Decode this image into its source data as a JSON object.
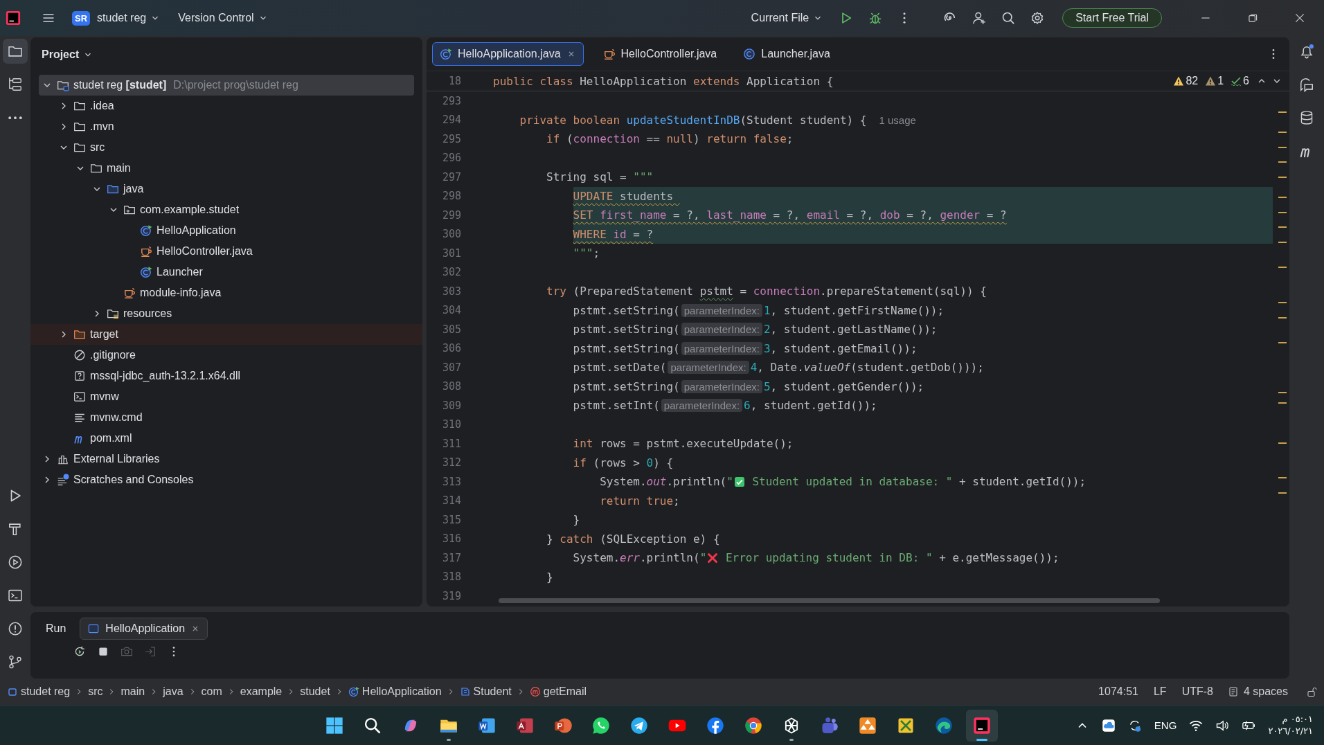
{
  "title_bar": {
    "project_badge": "SR",
    "project": "studet reg",
    "vcs": "Version Control",
    "run_config": "Current File",
    "trial_button": "Start Free Trial"
  },
  "left_toolbar": {
    "top": [
      {
        "kind": "project",
        "selected": true
      },
      {
        "kind": "structure",
        "selected": false
      },
      {
        "kind": "more",
        "selected": false
      }
    ],
    "bottom": [
      {
        "kind": "run",
        "selected": false
      },
      {
        "kind": "build",
        "selected": false
      },
      {
        "kind": "services",
        "selected": false
      },
      {
        "kind": "terminal",
        "selected": false
      },
      {
        "kind": "problems",
        "selected": false
      },
      {
        "kind": "git",
        "selected": false
      }
    ]
  },
  "project_panel": {
    "title": "Project",
    "tree": [
      {
        "label": "studet reg **[studet]**",
        "path": "D:\\project prog\\studet reg",
        "kind": "module",
        "expanded": true,
        "selected": true,
        "children": [
          {
            "label": ".idea",
            "kind": "folder",
            "expanded": false,
            "selected": false
          },
          {
            "label": ".mvn",
            "kind": "folder",
            "expanded": false,
            "selected": false
          },
          {
            "label": "src",
            "kind": "folder",
            "expanded": true,
            "selected": false,
            "children": [
              {
                "label": "main",
                "kind": "folder",
                "expanded": true,
                "selected": false,
                "children": [
                  {
                    "label": "java",
                    "kind": "source",
                    "expanded": true,
                    "selected": false,
                    "children": [
                      {
                        "label": "com.example.studet",
                        "kind": "package",
                        "expanded": true,
                        "selected": false,
                        "children": [
                          {
                            "label": "HelloApplication",
                            "kind": "class-run",
                            "selected": false
                          },
                          {
                            "label": "HelloController.java",
                            "kind": "java",
                            "selected": false
                          },
                          {
                            "label": "Launcher",
                            "kind": "class-run",
                            "selected": false
                          }
                        ]
                      },
                      {
                        "label": "module-info.java",
                        "kind": "java",
                        "selected": false
                      }
                    ]
                  },
                  {
                    "label": "resources",
                    "kind": "resources",
                    "expanded": false,
                    "selected": false
                  }
                ]
              }
            ]
          },
          {
            "label": "target",
            "kind": "excluded",
            "expanded": false,
            "selected": false
          },
          {
            "label": ".gitignore",
            "kind": "ignore",
            "selected": false
          },
          {
            "label": "mssql-jdbc_auth-13.2.1.x64.dll",
            "kind": "unknown",
            "selected": false
          },
          {
            "label": "mvnw",
            "kind": "terminal",
            "selected": false
          },
          {
            "label": "mvnw.cmd",
            "kind": "lines",
            "selected": false
          },
          {
            "label": "pom.xml",
            "kind": "maven",
            "selected": false
          }
        ]
      },
      {
        "label": "External Libraries",
        "kind": "library",
        "expanded": false,
        "selected": false
      },
      {
        "label": "Scratches and Consoles",
        "kind": "scratches",
        "expanded": false,
        "selected": false
      }
    ]
  },
  "editor": {
    "tabs": [
      {
        "label": "HelloApplication.java",
        "kind": "class-run",
        "selected": true
      },
      {
        "label": "HelloController.java",
        "kind": "java",
        "selected": false
      },
      {
        "label": "Launcher.java",
        "kind": "class",
        "selected": false
      }
    ],
    "sticky_line": {
      "number": "18",
      "tokens": [
        {
          "text": "public class ",
          "kind": "keyword"
        },
        {
          "text": "HelloApplication ",
          "kind": "plain"
        },
        {
          "text": "extends ",
          "kind": "keyword"
        },
        {
          "text": "Application {",
          "kind": "plain"
        }
      ]
    },
    "inspections": {
      "warnings": "82",
      "weak_warnings": "1",
      "typos": "6"
    },
    "lines": [
      {
        "number": "293",
        "highlighted": false
      },
      {
        "number": "294",
        "highlighted": false,
        "tokens": [
          {
            "text": "    private boolean ",
            "kind": "keyword"
          },
          {
            "text": "updateStudentInDB",
            "kind": "declaration"
          },
          {
            "text": "(Student student) {",
            "kind": "plain"
          },
          {
            "text": "1 usage",
            "kind": "usage"
          }
        ]
      },
      {
        "number": "295",
        "highlighted": false,
        "tokens": [
          {
            "text": "        if ",
            "kind": "keyword"
          },
          {
            "text": "(",
            "kind": "plain"
          },
          {
            "text": "connection",
            "kind": "field"
          },
          {
            "text": " == ",
            "kind": "plain"
          },
          {
            "text": "null",
            "kind": "keyword"
          },
          {
            "text": ") ",
            "kind": "plain"
          },
          {
            "text": "return false",
            "kind": "keyword"
          },
          {
            "text": ";",
            "kind": "plain"
          }
        ]
      },
      {
        "number": "296",
        "highlighted": false
      },
      {
        "number": "297",
        "highlighted": false,
        "tokens": [
          {
            "text": "        String sql = ",
            "kind": "plain"
          },
          {
            "text": "\"\"\"",
            "kind": "string"
          }
        ]
      },
      {
        "number": "298",
        "highlighted": true,
        "tokens": [
          {
            "text": "            UPDATE",
            "kind": "sql-keyword",
            "warning": true
          },
          {
            "text": " students ",
            "kind": "plain",
            "warning": true
          }
        ]
      },
      {
        "number": "299",
        "highlighted": true,
        "tokens": [
          {
            "text": "            SET ",
            "kind": "sql-keyword",
            "warning": true
          },
          {
            "text": "first_name",
            "kind": "field",
            "warning": true
          },
          {
            "text": " = ?, ",
            "kind": "plain",
            "warning": true
          },
          {
            "text": "last_name",
            "kind": "field",
            "warning": true
          },
          {
            "text": " = ?, ",
            "kind": "plain",
            "warning": true
          },
          {
            "text": "email",
            "kind": "field",
            "warning": true
          },
          {
            "text": " = ?, ",
            "kind": "plain",
            "warning": true
          },
          {
            "text": "dob",
            "kind": "field",
            "warning": true
          },
          {
            "text": " = ?, ",
            "kind": "plain",
            "warning": true
          },
          {
            "text": "gender",
            "kind": "field",
            "warning": true
          },
          {
            "text": " = ?",
            "kind": "plain",
            "warning": true
          }
        ]
      },
      {
        "number": "300",
        "highlighted": true,
        "tokens": [
          {
            "text": "            WHERE ",
            "kind": "sql-keyword",
            "warning": true
          },
          {
            "text": "id",
            "kind": "field",
            "warning": true
          },
          {
            "text": " = ?",
            "kind": "plain",
            "warning": true
          }
        ]
      },
      {
        "number": "301",
        "highlighted": false,
        "tokens": [
          {
            "text": "            \"\"\"",
            "kind": "string"
          },
          {
            "text": ";",
            "kind": "plain"
          }
        ]
      },
      {
        "number": "302",
        "highlighted": false
      },
      {
        "number": "303",
        "highlighted": false,
        "tokens": [
          {
            "text": "        try ",
            "kind": "keyword"
          },
          {
            "text": "(PreparedStatement ",
            "kind": "plain"
          },
          {
            "text": "pstmt",
            "kind": "plain",
            "typo": true
          },
          {
            "text": " = ",
            "kind": "plain"
          },
          {
            "text": "connection",
            "kind": "field"
          },
          {
            "text": ".prepareStatement(sql)) {",
            "kind": "plain"
          }
        ]
      },
      {
        "number": "304",
        "highlighted": false,
        "tokens": [
          {
            "text": "            pstmt.setString(",
            "kind": "plain"
          },
          {
            "text": "parameterIndex:",
            "kind": "hint"
          },
          {
            "text": "1",
            "kind": "number"
          },
          {
            "text": ", student.getFirstName());",
            "kind": "plain"
          }
        ]
      },
      {
        "number": "305",
        "highlighted": false,
        "tokens": [
          {
            "text": "            pstmt.setString(",
            "kind": "plain"
          },
          {
            "text": "parameterIndex:",
            "kind": "hint"
          },
          {
            "text": "2",
            "kind": "number"
          },
          {
            "text": ", student.getLastName());",
            "kind": "plain"
          }
        ]
      },
      {
        "number": "306",
        "highlighted": false,
        "tokens": [
          {
            "text": "            pstmt.setString(",
            "kind": "plain"
          },
          {
            "text": "parameterIndex:",
            "kind": "hint"
          },
          {
            "text": "3",
            "kind": "number"
          },
          {
            "text": ", student.getEmail());",
            "kind": "plain"
          }
        ]
      },
      {
        "number": "307",
        "highlighted": false,
        "tokens": [
          {
            "text": "            pstmt.setDate(",
            "kind": "plain"
          },
          {
            "text": "parameterIndex:",
            "kind": "hint"
          },
          {
            "text": "4",
            "kind": "number"
          },
          {
            "text": ", Date.",
            "kind": "plain"
          },
          {
            "text": "valueOf",
            "kind": "static-method"
          },
          {
            "text": "(student.getDob()));",
            "kind": "plain"
          }
        ]
      },
      {
        "number": "308",
        "highlighted": false,
        "tokens": [
          {
            "text": "            pstmt.setString(",
            "kind": "plain"
          },
          {
            "text": "parameterIndex:",
            "kind": "hint"
          },
          {
            "text": "5",
            "kind": "number"
          },
          {
            "text": ", student.getGender());",
            "kind": "plain"
          }
        ]
      },
      {
        "number": "309",
        "highlighted": false,
        "tokens": [
          {
            "text": "            pstmt.setInt(",
            "kind": "plain"
          },
          {
            "text": "parameterIndex:",
            "kind": "hint"
          },
          {
            "text": "6",
            "kind": "number"
          },
          {
            "text": ", student.getId());",
            "kind": "plain"
          }
        ]
      },
      {
        "number": "310",
        "highlighted": false
      },
      {
        "number": "311",
        "highlighted": false,
        "tokens": [
          {
            "text": "            int ",
            "kind": "keyword"
          },
          {
            "text": "rows = pstmt.executeUpdate();",
            "kind": "plain"
          }
        ]
      },
      {
        "number": "312",
        "highlighted": false,
        "tokens": [
          {
            "text": "            if ",
            "kind": "keyword"
          },
          {
            "text": "(rows > ",
            "kind": "plain"
          },
          {
            "text": "0",
            "kind": "number"
          },
          {
            "text": ") {",
            "kind": "plain"
          }
        ]
      },
      {
        "number": "313",
        "highlighted": false,
        "tokens": [
          {
            "text": "                System.",
            "kind": "plain"
          },
          {
            "text": "out",
            "kind": "static-field"
          },
          {
            "text": ".println(",
            "kind": "plain"
          },
          {
            "text": "\"",
            "kind": "string"
          },
          {
            "kind": "check-emoji"
          },
          {
            "text": " Student updated in database: \"",
            "kind": "string"
          },
          {
            "text": " + student.getId());",
            "kind": "plain"
          }
        ]
      },
      {
        "number": "314",
        "highlighted": false,
        "tokens": [
          {
            "text": "                return true",
            "kind": "keyword"
          },
          {
            "text": ";",
            "kind": "plain"
          }
        ]
      },
      {
        "number": "315",
        "highlighted": false,
        "tokens": [
          {
            "text": "            }",
            "kind": "plain"
          }
        ]
      },
      {
        "number": "316",
        "highlighted": false,
        "tokens": [
          {
            "text": "        } ",
            "kind": "plain"
          },
          {
            "text": "catch ",
            "kind": "keyword"
          },
          {
            "text": "(SQLException e) {",
            "kind": "plain"
          }
        ]
      },
      {
        "number": "317",
        "highlighted": false,
        "tokens": [
          {
            "text": "            System.",
            "kind": "plain"
          },
          {
            "text": "err",
            "kind": "static-field"
          },
          {
            "text": ".println(",
            "kind": "plain"
          },
          {
            "text": "\"",
            "kind": "string"
          },
          {
            "kind": "cross-emoji"
          },
          {
            "text": " Error updating student in DB: \"",
            "kind": "string"
          },
          {
            "text": " + e.getMessage());",
            "kind": "plain"
          }
        ]
      },
      {
        "number": "318",
        "highlighted": false,
        "tokens": [
          {
            "text": "        }",
            "kind": "plain"
          }
        ]
      },
      {
        "number": "319",
        "highlighted": false
      }
    ]
  },
  "right_toolbar": [
    {
      "kind": "notifications"
    },
    {
      "kind": "ai-chat"
    },
    {
      "kind": "database"
    },
    {
      "kind": "maven"
    }
  ],
  "run_panel": {
    "title": "Run",
    "tabs": [
      {
        "label": "HelloApplication",
        "selected": true
      }
    ],
    "tools": [
      {
        "kind": "rerun",
        "disabled": false
      },
      {
        "kind": "stop",
        "disabled": false
      },
      {
        "kind": "camera",
        "disabled": true
      },
      {
        "kind": "exit",
        "disabled": true
      },
      {
        "kind": "more",
        "disabled": false
      }
    ]
  },
  "status_bar": {
    "breadcrumbs": [
      {
        "label": "studet reg",
        "kind": "module-small"
      },
      {
        "label": "src",
        "kind": "plain"
      },
      {
        "label": "main",
        "kind": "plain"
      },
      {
        "label": "java",
        "kind": "plain"
      },
      {
        "label": "com",
        "kind": "plain"
      },
      {
        "label": "example",
        "kind": "plain"
      },
      {
        "label": "studet",
        "kind": "plain"
      },
      {
        "label": "HelloApplication",
        "kind": "class-run"
      },
      {
        "label": "Student",
        "kind": "record"
      },
      {
        "label": "getEmail",
        "kind": "method"
      }
    ],
    "position": "1074:51",
    "line_separator": "LF",
    "encoding": "UTF-8",
    "indent": "4 spaces"
  },
  "taskbar": {
    "apps": [
      {
        "kind": "start",
        "running": false,
        "selected": false
      },
      {
        "kind": "search",
        "running": false,
        "selected": false
      },
      {
        "kind": "copilot",
        "running": false,
        "selected": false
      },
      {
        "kind": "files",
        "running": true,
        "selected": false
      },
      {
        "kind": "word",
        "running": false,
        "selected": false
      },
      {
        "kind": "access",
        "running": false,
        "selected": false
      },
      {
        "kind": "slides",
        "running": false,
        "selected": false
      },
      {
        "kind": "chat",
        "running": false,
        "selected": false
      },
      {
        "kind": "plane",
        "running": false,
        "selected": false
      },
      {
        "kind": "video",
        "running": false,
        "selected": false
      },
      {
        "kind": "social",
        "running": false,
        "selected": false
      },
      {
        "kind": "browser",
        "running": false,
        "selected": false
      },
      {
        "kind": "knot",
        "running": true,
        "selected": false
      },
      {
        "kind": "teams",
        "running": false,
        "selected": false
      },
      {
        "kind": "triangles",
        "running": false,
        "selected": false
      },
      {
        "kind": "tools",
        "running": false,
        "selected": false
      },
      {
        "kind": "edge",
        "running": false,
        "selected": false
      },
      {
        "kind": "ide",
        "running": true,
        "selected": true
      }
    ],
    "language": "ENG",
    "time": "٠٥:٠١ م",
    "date": "٢٠٢٦/٠٢/٢١"
  }
}
